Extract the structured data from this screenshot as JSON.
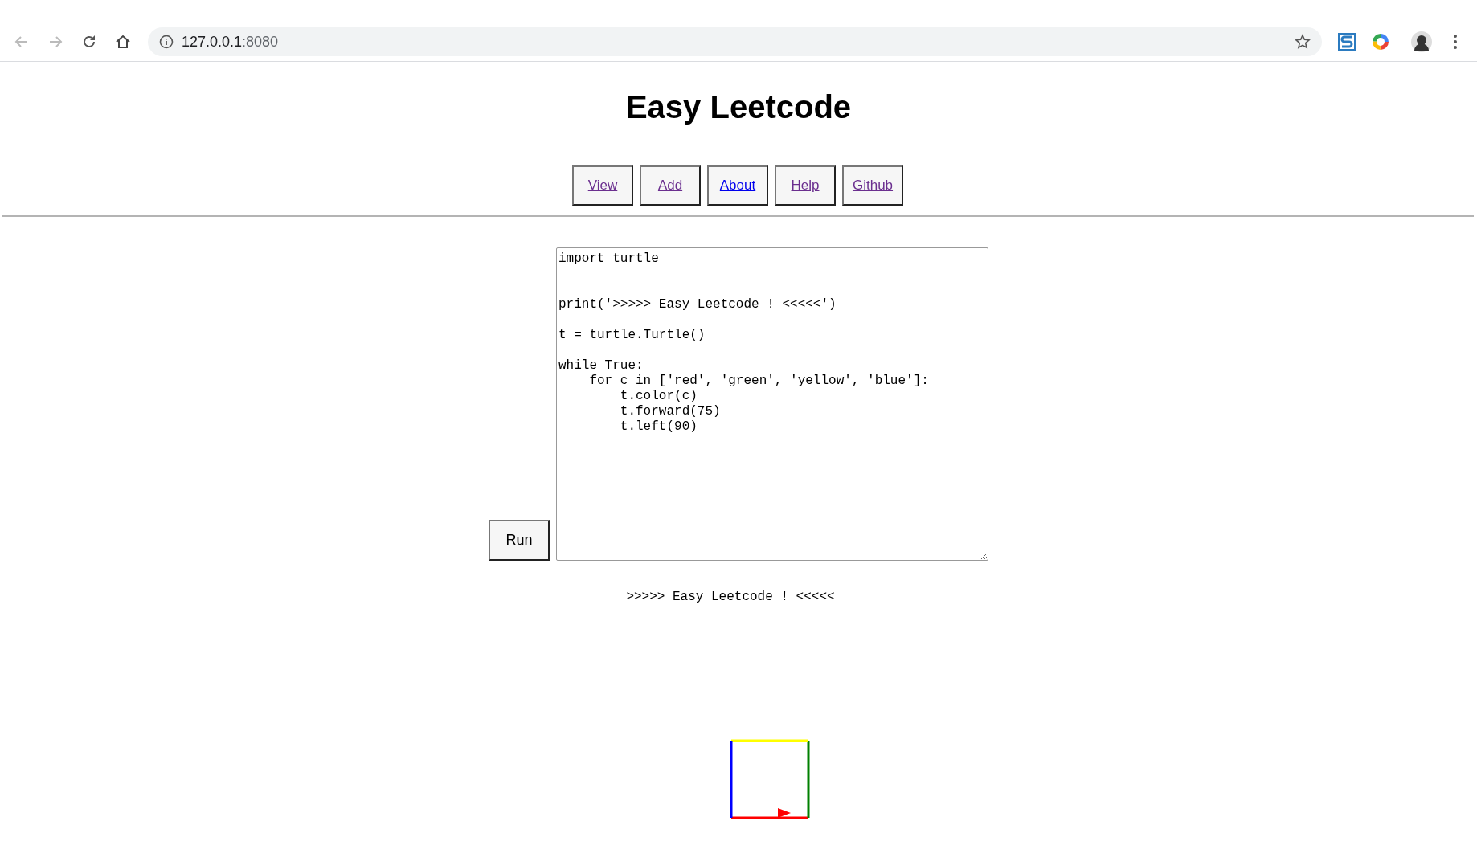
{
  "browser": {
    "address": {
      "host": "127.0.0.1",
      "port": ":8080"
    }
  },
  "page": {
    "title": "Easy Leetcode",
    "nav": [
      {
        "label": "View",
        "visited": true
      },
      {
        "label": "Add",
        "visited": true
      },
      {
        "label": "About",
        "visited": false
      },
      {
        "label": "Help",
        "visited": true
      },
      {
        "label": "Github",
        "visited": true
      }
    ],
    "run_button": "Run",
    "code": "import turtle\n\n\nprint('>>>>> Easy Leetcode ! <<<<<')\n\nt = turtle.Turtle()\n\nwhile True:\n    for c in ['red', 'green', 'yellow', 'blue']:\n        t.color(c)\n        t.forward(75)\n        t.left(90)",
    "output": ">>>>> Easy Leetcode ! <<<<<"
  }
}
